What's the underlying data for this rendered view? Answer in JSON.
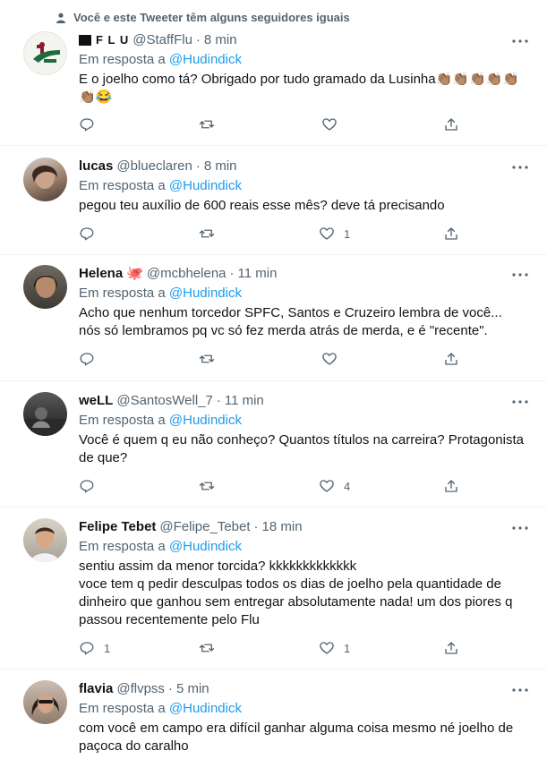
{
  "social_context": "Você e este Tweeter têm alguns seguidores iguais",
  "reply_prefix": "Em resposta a",
  "tweets": [
    {
      "name": "F L U",
      "handle": "@StaffFlu",
      "sep": "·",
      "time": "8 min",
      "reply_to": "@Hudindick",
      "text": "E o joelho como tá? Obrigado por tudo gramado da Lusinha👏🏽👏🏽👏🏽👏🏽👏🏽",
      "text2": "👏🏽😂",
      "replies": "",
      "retweets": "",
      "likes": ""
    },
    {
      "name": "lucas",
      "handle": "@blueclaren",
      "sep": "·",
      "time": "8 min",
      "reply_to": "@Hudindick",
      "text": "pegou teu auxílio de 600 reais esse mês? deve tá precisando",
      "replies": "",
      "retweets": "",
      "likes": "1"
    },
    {
      "name": "Helena",
      "name_emoji": "🐙",
      "handle": "@mcbhelena",
      "sep": "·",
      "time": "11 min",
      "reply_to": "@Hudindick",
      "text": "Acho que nenhum torcedor SPFC, Santos e Cruzeiro lembra de você... nós só lembramos pq vc só fez merda atrás de merda, e é \"recente\".",
      "replies": "",
      "retweets": "",
      "likes": ""
    },
    {
      "name": "weLL",
      "handle": "@SantosWell_7",
      "sep": "·",
      "time": "11 min",
      "reply_to": "@Hudindick",
      "text": "Você é quem q eu não conheço? Quantos títulos na carreira? Protagonista de que?",
      "replies": "",
      "retweets": "",
      "likes": "4"
    },
    {
      "name": "Felipe Tebet",
      "handle": "@Felipe_Tebet",
      "sep": "·",
      "time": "18 min",
      "reply_to": "@Hudindick",
      "text": "sentiu assim da menor torcida? kkkkkkkkkkkkk",
      "text2": "voce tem q pedir desculpas todos os dias de joelho pela quantidade de dinheiro que ganhou sem entregar absolutamente nada! um dos piores q passou recentemente pelo Flu",
      "replies": "1",
      "retweets": "",
      "likes": "1"
    },
    {
      "name": "flavia",
      "handle": "@flvpss",
      "sep": "·",
      "time": "5 min",
      "reply_to": "@Hudindick",
      "text": "com você em campo era difícil ganhar alguma coisa mesmo né joelho de paçoca do caralho"
    }
  ]
}
